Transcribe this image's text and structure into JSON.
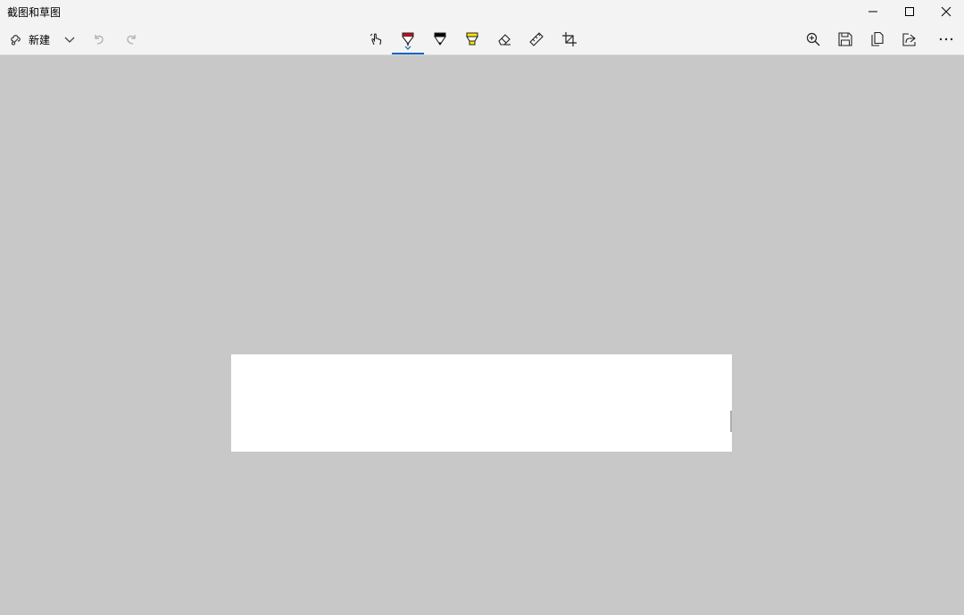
{
  "window": {
    "title": "截图和草图",
    "controls": [
      "minimize-icon",
      "maximize-icon",
      "close-icon"
    ]
  },
  "toolbar": {
    "new_label": "新建",
    "left_icons": [
      "new-snip-icon",
      "chevron-down-icon",
      "undo-icon",
      "redo-icon"
    ],
    "center_tools": [
      "touch-writing-icon",
      "ballpoint-pen-icon",
      "pencil-icon",
      "highlighter-icon",
      "eraser-icon",
      "ruler-icon",
      "crop-icon"
    ],
    "selected_tool": "ballpoint-pen-icon",
    "right_icons": [
      "zoom-in-icon",
      "save-icon",
      "copy-icon",
      "share-icon",
      "more-icon"
    ],
    "colors": {
      "pen": "#c50f1f",
      "pencil": "#000000",
      "highlighter": "#ffe600",
      "accent": "#0067c0"
    }
  },
  "canvas": {
    "background": "#c8c8c8",
    "paper_color": "#ffffff"
  }
}
